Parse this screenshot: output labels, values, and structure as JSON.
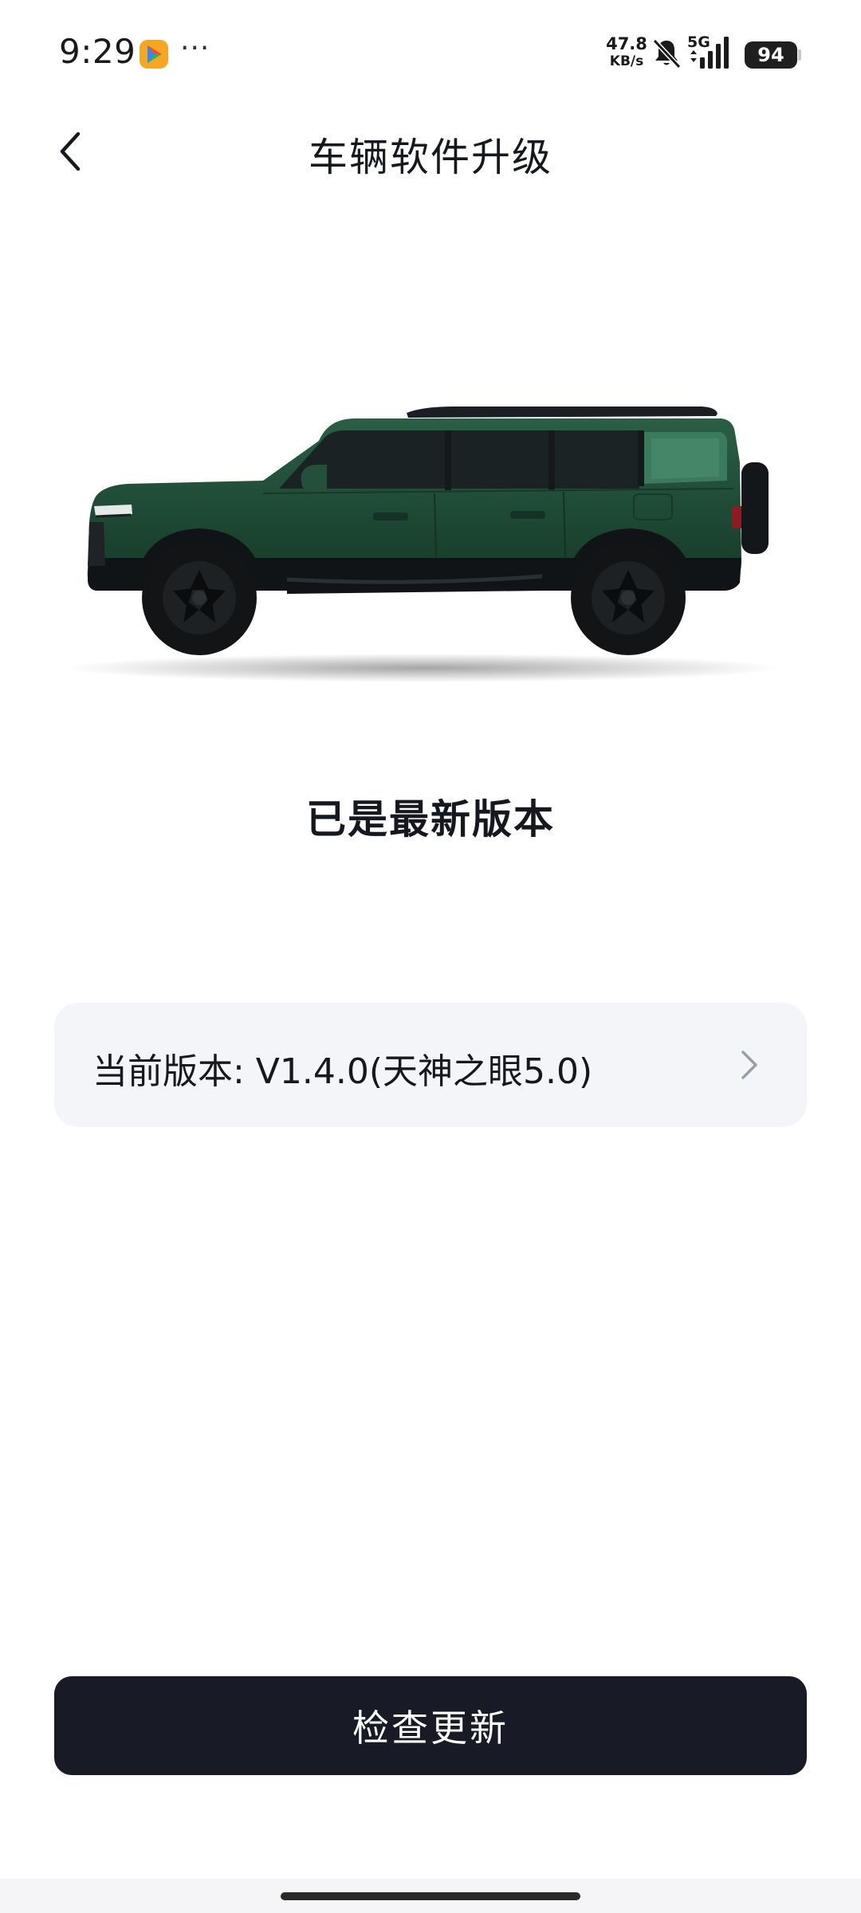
{
  "status_bar": {
    "time": "9:29",
    "more_indicator": "···",
    "net_speed_value": "47.8",
    "net_speed_unit": "KB/s",
    "network_type": "5G",
    "battery_level": "94",
    "icons": [
      "app-store-icon",
      "bell-off-icon",
      "signal-icon",
      "battery-icon"
    ]
  },
  "header": {
    "title": "车辆软件升级",
    "back_icon": "chevron-left-icon"
  },
  "vehicle": {
    "image_icon": "suv-image",
    "body_color": "#1e4a35"
  },
  "update_status": {
    "message": "已是最新版本"
  },
  "version_card": {
    "label": "当前版本: V1.4.0(天神之眼5.0)",
    "chevron_icon": "chevron-right-icon"
  },
  "actions": {
    "check_update_label": "检查更新"
  },
  "colors": {
    "button_bg": "#181b26",
    "card_bg": "#f4f5f9",
    "text_primary": "#16181f"
  }
}
